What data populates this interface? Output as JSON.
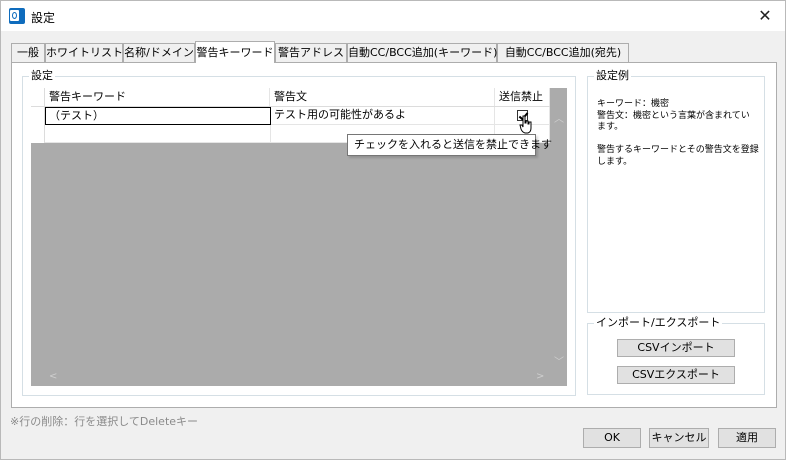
{
  "window": {
    "title": "設定",
    "close_glyph": "✕"
  },
  "tabs": [
    {
      "label": "一般"
    },
    {
      "label": "ホワイトリスト"
    },
    {
      "label": "名称/ドメイン"
    },
    {
      "label": "警告キーワード"
    },
    {
      "label": "警告アドレス"
    },
    {
      "label": "自動CC/BCC追加(キーワード)"
    },
    {
      "label": "自動CC/BCC追加(宛先)"
    }
  ],
  "settings_group": {
    "label": "設定"
  },
  "grid": {
    "columns": [
      "警告キーワード",
      "警告文",
      "送信禁止"
    ],
    "rows": [
      {
        "keyword": "（テスト）",
        "message": "テスト用の可能性があるよ",
        "block_send": true
      }
    ],
    "tooltip": "チェックを入れると送信を禁止できます"
  },
  "example_group": {
    "label": "設定例",
    "lines": [
      "キーワード：機密",
      "警告文：機密という言葉が含まれてい",
      "ます。",
      "",
      "警告するキーワードとその警告文を登録",
      "します。"
    ]
  },
  "import_export": {
    "label": "インポート/エクスポート",
    "import_label": "CSVインポート",
    "export_label": "CSVエクスポート"
  },
  "footer": {
    "note": "※行の削除：行を選択してDeleteキー",
    "ok_label": "OK",
    "cancel_label": "キャンセル",
    "apply_label": "適用"
  },
  "colors": {
    "accent": "#0078d7",
    "grid_background": "#ababab",
    "app_icon": "#0f6cbd"
  }
}
